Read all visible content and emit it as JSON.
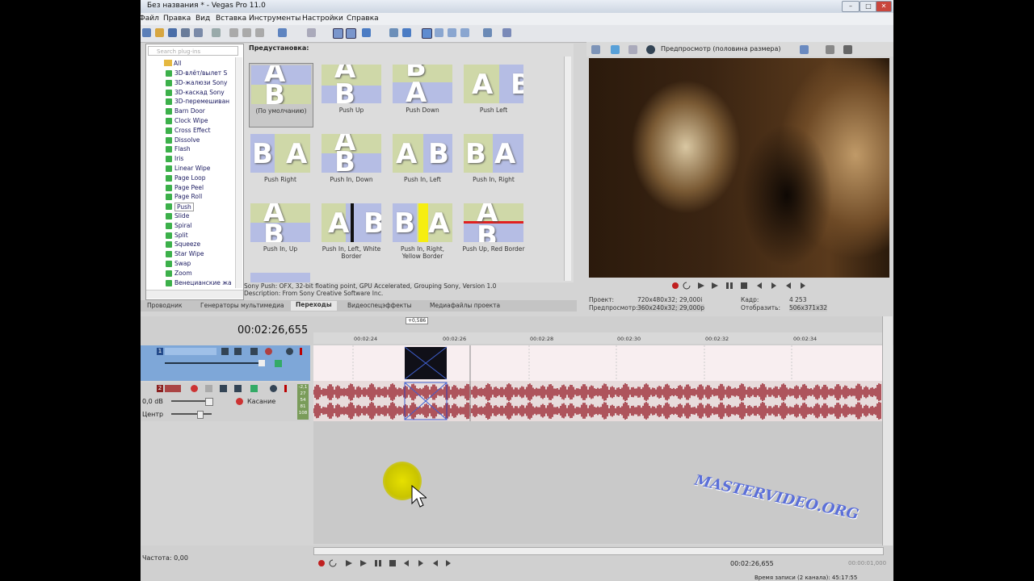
{
  "window": {
    "title": "Без названия * - Vegas Pro 11.0"
  },
  "menu": [
    "Файл",
    "Правка",
    "Вид",
    "Вставка",
    "Инструменты",
    "Настройки",
    "Справка"
  ],
  "browser": {
    "search_placeholder": "Search plug-ins",
    "root": "All",
    "items": [
      "3D-влёт/вылет S",
      "3D-жалюзи Sony",
      "3D-каскад Sony",
      "3D-перемешиван",
      "Barn Door",
      "Clock Wipe",
      "Cross Effect",
      "Dissolve",
      "Flash",
      "Iris",
      "Linear Wipe",
      "Page Loop",
      "Page Peel",
      "Page Roll",
      "Push",
      "Slide",
      "Spiral",
      "Split",
      "Squeeze",
      "Star Wipe",
      "Swap",
      "Zoom",
      "Венецианские жа"
    ],
    "selected": "Push",
    "presets_title": "Предустановка:",
    "presets": [
      "(По умолчанию)",
      "Push Up",
      "Push Down",
      "Push Left",
      "Push Right",
      "Push In, Down",
      "Push In, Left",
      "Push In, Right",
      "Push In, Up",
      "Push In, Left, White Border",
      "Push In, Right, Yellow Border",
      "Push Up, Red Border"
    ],
    "info_line1": "Sony Push: OFX, 32-bit floating point, GPU Accelerated, Grouping Sony, Version 1.0",
    "info_line2": "Description: From Sony Creative Software Inc.",
    "tabs": [
      "Проводник",
      "Генераторы мультимедиа",
      "Переходы",
      "Видеоспецэффекты",
      "Медиафайлы проекта"
    ],
    "active_tab": "Переходы"
  },
  "preview": {
    "mode": "Предпросмотр (половина размера)",
    "project_label": "Проект:",
    "project_value": "720x480x32; 29,000i",
    "preview_label": "Предпросмотр:",
    "preview_value": "360x240x32; 29,000p",
    "frame_label": "Кадр:",
    "frame_value": "4 253",
    "display_label": "Отобразить:",
    "display_value": "506x371x32"
  },
  "timeline": {
    "timecode": "00:02:26,655",
    "marker": "+0,586",
    "ticks": [
      "00:02:24",
      "00:02:26",
      "00:02:28",
      "00:02:30",
      "00:02:32",
      "00:02:34"
    ],
    "track1_num": "1",
    "track2_num": "2",
    "volume": "0,0 dB",
    "pan": "Центр",
    "mode": "Касание",
    "meter": [
      "-2,1",
      "27",
      "54",
      "81",
      "108"
    ],
    "rate": "Частота: 0,00",
    "cursor_time": "00:02:26,655",
    "end_time": "00:00:01,000",
    "record_status": "Время записи (2 канала): 45:17:55"
  },
  "watermark": "MASTERVIDEO.ORG"
}
